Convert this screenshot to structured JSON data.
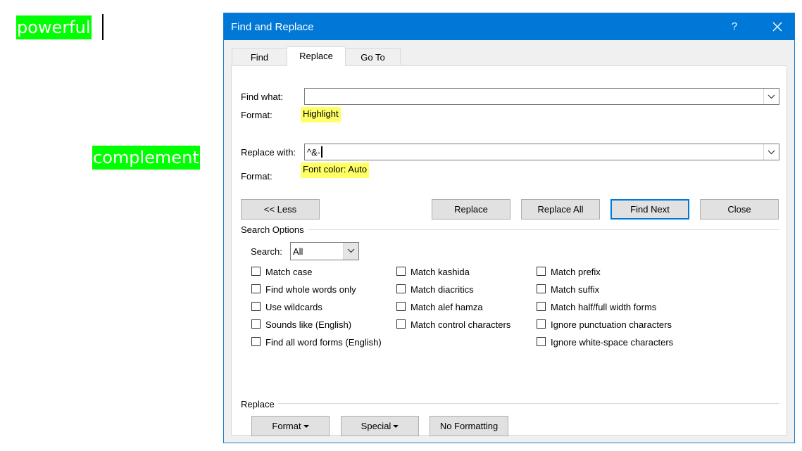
{
  "document": {
    "word1": "powerful",
    "word2": "complement",
    "highlight_color": "#00ff00"
  },
  "dialog": {
    "title": "Find and Replace",
    "help_label": "?",
    "close_icon": "close-icon",
    "titlebar_color": "#0078d7",
    "tabs": [
      {
        "label": "Find"
      },
      {
        "label": "Replace",
        "active": true
      },
      {
        "label": "Go To"
      }
    ],
    "find": {
      "label": "Find what:",
      "value": "",
      "format_label": "Format:",
      "format_value": "Highlight"
    },
    "replace": {
      "label": "Replace with:",
      "value": "^&-",
      "format_label": "Format:",
      "format_value": "Font color: Auto"
    },
    "buttons": {
      "less": "<< Less",
      "replace": "Replace",
      "replace_all": "Replace All",
      "find_next": "Find Next",
      "close": "Close"
    },
    "search_options": {
      "heading": "Search Options",
      "search_label": "Search:",
      "search_value": "All",
      "col1": [
        {
          "label": "Match case",
          "checked": false
        },
        {
          "label": "Find whole words only",
          "checked": false
        },
        {
          "label": "Use wildcards",
          "checked": false
        },
        {
          "label": "Sounds like (English)",
          "checked": false
        },
        {
          "label": "Find all word forms (English)",
          "checked": false
        }
      ],
      "col2": [
        {
          "label": "Match kashida",
          "checked": false
        },
        {
          "label": "Match diacritics",
          "checked": false
        },
        {
          "label": "Match alef hamza",
          "checked": false
        },
        {
          "label": "Match control characters",
          "checked": false
        }
      ],
      "col3": [
        {
          "label": "Match prefix",
          "checked": false
        },
        {
          "label": "Match suffix",
          "checked": false
        },
        {
          "label": "Match half/full width forms",
          "checked": false
        },
        {
          "label": "Ignore punctuation characters",
          "checked": false
        },
        {
          "label": "Ignore white-space characters",
          "checked": false
        }
      ]
    },
    "replace_section": {
      "heading": "Replace",
      "format_button": "Format",
      "special_button": "Special",
      "no_formatting_button": "No Formatting"
    },
    "highlight_yellow": "#ffff66"
  }
}
